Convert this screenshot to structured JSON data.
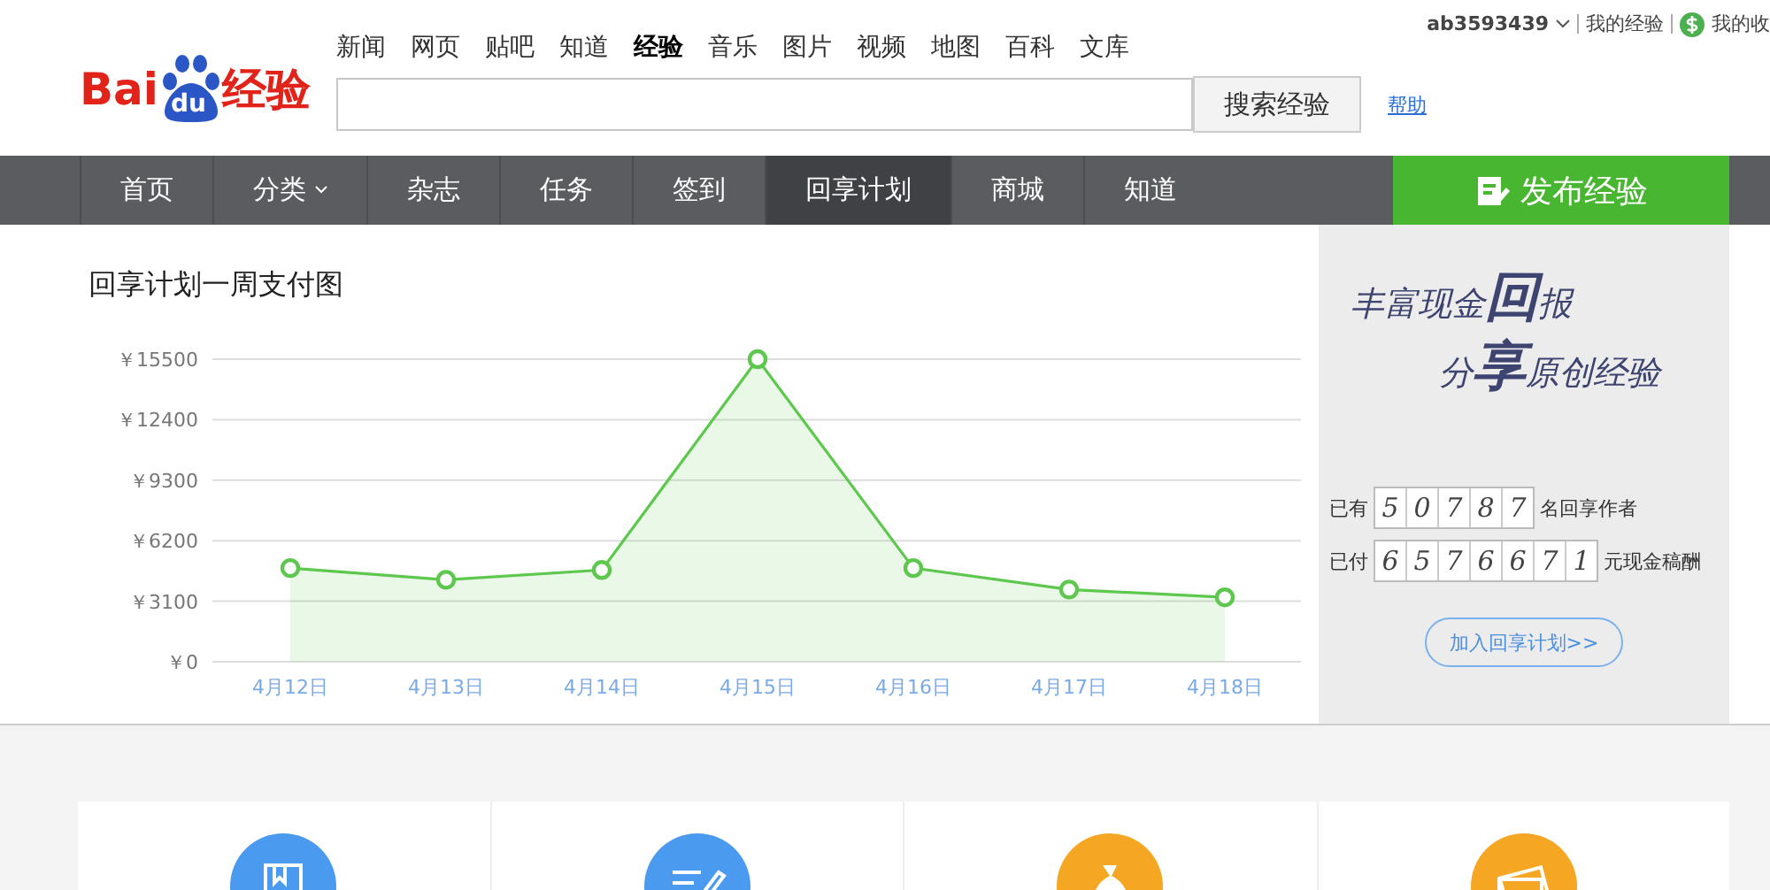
{
  "header": {
    "logo": {
      "left": "Bai",
      "paw": "du",
      "right": "经验"
    },
    "top_links": [
      {
        "label": "新闻",
        "selected": false
      },
      {
        "label": "网页",
        "selected": false
      },
      {
        "label": "贴吧",
        "selected": false
      },
      {
        "label": "知道",
        "selected": false
      },
      {
        "label": "经验",
        "selected": true
      },
      {
        "label": "音乐",
        "selected": false
      },
      {
        "label": "图片",
        "selected": false
      },
      {
        "label": "视频",
        "selected": false
      },
      {
        "label": "地图",
        "selected": false
      },
      {
        "label": "百科",
        "selected": false
      },
      {
        "label": "文库",
        "selected": false
      }
    ],
    "search_button": "搜索经验",
    "help_link": "帮助",
    "user": {
      "name": "ab3593439",
      "my_experience": "我的经验",
      "my_income": "我的收"
    }
  },
  "nav": {
    "items": [
      {
        "label": "首页",
        "selected": false,
        "dropdown": false
      },
      {
        "label": "分类",
        "selected": false,
        "dropdown": true
      },
      {
        "label": "杂志",
        "selected": false,
        "dropdown": false
      },
      {
        "label": "任务",
        "selected": false,
        "dropdown": false
      },
      {
        "label": "签到",
        "selected": false,
        "dropdown": false
      },
      {
        "label": "回享计划",
        "selected": true,
        "dropdown": false
      },
      {
        "label": "商城",
        "selected": false,
        "dropdown": false
      },
      {
        "label": "知道",
        "selected": false,
        "dropdown": false
      }
    ],
    "publish_button": "发布经验"
  },
  "chart_panel": {
    "title": "回享计划一周支付图",
    "chart_data": {
      "type": "area",
      "categories": [
        "4月12日",
        "4月13日",
        "4月14日",
        "4月15日",
        "4月16日",
        "4月17日",
        "4月18日"
      ],
      "grid": true,
      "series": [
        {
          "color": "#5ec84e",
          "values": [
            4800,
            4200,
            4700,
            15500,
            4800,
            3700,
            3300
          ]
        }
      ],
      "ylim": [
        0,
        15500
      ],
      "yticks": [
        {
          "value": 0,
          "label": "￥0"
        },
        {
          "value": 3100,
          "label": "￥3100"
        },
        {
          "value": 6200,
          "label": "￥6200"
        },
        {
          "value": 9300,
          "label": "￥9300"
        },
        {
          "value": 12400,
          "label": "￥12400"
        },
        {
          "value": 15500,
          "label": "￥15500"
        }
      ]
    }
  },
  "promo": {
    "slogan": [
      "丰富现金**回**报",
      "分**享**原创经验"
    ],
    "counters": [
      {
        "prefix": "已有",
        "digits": [
          "5",
          "0",
          "7",
          "8",
          "7"
        ],
        "suffix": "名回享作者"
      },
      {
        "prefix": "已付",
        "digits": [
          "6",
          "5",
          "7",
          "6",
          "6",
          "7",
          "1"
        ],
        "suffix": "元现金稿酬"
      }
    ],
    "join_button": "加入回享计划>>"
  },
  "features": [
    {
      "kind": "book",
      "color": "#4a9af0"
    },
    {
      "kind": "edit",
      "color": "#4a9af0"
    },
    {
      "kind": "moneybag",
      "color": "#f5a623"
    },
    {
      "kind": "cards",
      "color": "#f5a623"
    }
  ]
}
